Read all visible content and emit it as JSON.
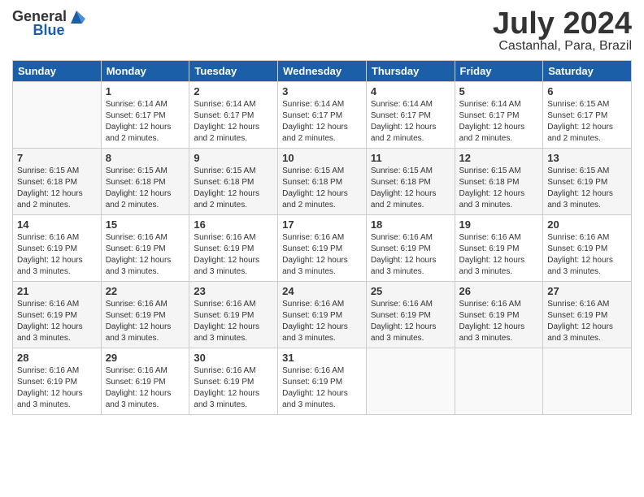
{
  "header": {
    "logo_general": "General",
    "logo_blue": "Blue",
    "month_title": "July 2024",
    "location": "Castanhal, Para, Brazil"
  },
  "days_of_week": [
    "Sunday",
    "Monday",
    "Tuesday",
    "Wednesday",
    "Thursday",
    "Friday",
    "Saturday"
  ],
  "weeks": [
    [
      {
        "day": "",
        "info": ""
      },
      {
        "day": "1",
        "info": "Sunrise: 6:14 AM\nSunset: 6:17 PM\nDaylight: 12 hours\nand 2 minutes."
      },
      {
        "day": "2",
        "info": "Sunrise: 6:14 AM\nSunset: 6:17 PM\nDaylight: 12 hours\nand 2 minutes."
      },
      {
        "day": "3",
        "info": "Sunrise: 6:14 AM\nSunset: 6:17 PM\nDaylight: 12 hours\nand 2 minutes."
      },
      {
        "day": "4",
        "info": "Sunrise: 6:14 AM\nSunset: 6:17 PM\nDaylight: 12 hours\nand 2 minutes."
      },
      {
        "day": "5",
        "info": "Sunrise: 6:14 AM\nSunset: 6:17 PM\nDaylight: 12 hours\nand 2 minutes."
      },
      {
        "day": "6",
        "info": "Sunrise: 6:15 AM\nSunset: 6:17 PM\nDaylight: 12 hours\nand 2 minutes."
      }
    ],
    [
      {
        "day": "7",
        "info": "Sunrise: 6:15 AM\nSunset: 6:18 PM\nDaylight: 12 hours\nand 2 minutes."
      },
      {
        "day": "8",
        "info": "Sunrise: 6:15 AM\nSunset: 6:18 PM\nDaylight: 12 hours\nand 2 minutes."
      },
      {
        "day": "9",
        "info": "Sunrise: 6:15 AM\nSunset: 6:18 PM\nDaylight: 12 hours\nand 2 minutes."
      },
      {
        "day": "10",
        "info": "Sunrise: 6:15 AM\nSunset: 6:18 PM\nDaylight: 12 hours\nand 2 minutes."
      },
      {
        "day": "11",
        "info": "Sunrise: 6:15 AM\nSunset: 6:18 PM\nDaylight: 12 hours\nand 2 minutes."
      },
      {
        "day": "12",
        "info": "Sunrise: 6:15 AM\nSunset: 6:18 PM\nDaylight: 12 hours\nand 3 minutes."
      },
      {
        "day": "13",
        "info": "Sunrise: 6:15 AM\nSunset: 6:19 PM\nDaylight: 12 hours\nand 3 minutes."
      }
    ],
    [
      {
        "day": "14",
        "info": "Sunrise: 6:16 AM\nSunset: 6:19 PM\nDaylight: 12 hours\nand 3 minutes."
      },
      {
        "day": "15",
        "info": "Sunrise: 6:16 AM\nSunset: 6:19 PM\nDaylight: 12 hours\nand 3 minutes."
      },
      {
        "day": "16",
        "info": "Sunrise: 6:16 AM\nSunset: 6:19 PM\nDaylight: 12 hours\nand 3 minutes."
      },
      {
        "day": "17",
        "info": "Sunrise: 6:16 AM\nSunset: 6:19 PM\nDaylight: 12 hours\nand 3 minutes."
      },
      {
        "day": "18",
        "info": "Sunrise: 6:16 AM\nSunset: 6:19 PM\nDaylight: 12 hours\nand 3 minutes."
      },
      {
        "day": "19",
        "info": "Sunrise: 6:16 AM\nSunset: 6:19 PM\nDaylight: 12 hours\nand 3 minutes."
      },
      {
        "day": "20",
        "info": "Sunrise: 6:16 AM\nSunset: 6:19 PM\nDaylight: 12 hours\nand 3 minutes."
      }
    ],
    [
      {
        "day": "21",
        "info": "Sunrise: 6:16 AM\nSunset: 6:19 PM\nDaylight: 12 hours\nand 3 minutes."
      },
      {
        "day": "22",
        "info": "Sunrise: 6:16 AM\nSunset: 6:19 PM\nDaylight: 12 hours\nand 3 minutes."
      },
      {
        "day": "23",
        "info": "Sunrise: 6:16 AM\nSunset: 6:19 PM\nDaylight: 12 hours\nand 3 minutes."
      },
      {
        "day": "24",
        "info": "Sunrise: 6:16 AM\nSunset: 6:19 PM\nDaylight: 12 hours\nand 3 minutes."
      },
      {
        "day": "25",
        "info": "Sunrise: 6:16 AM\nSunset: 6:19 PM\nDaylight: 12 hours\nand 3 minutes."
      },
      {
        "day": "26",
        "info": "Sunrise: 6:16 AM\nSunset: 6:19 PM\nDaylight: 12 hours\nand 3 minutes."
      },
      {
        "day": "27",
        "info": "Sunrise: 6:16 AM\nSunset: 6:19 PM\nDaylight: 12 hours\nand 3 minutes."
      }
    ],
    [
      {
        "day": "28",
        "info": "Sunrise: 6:16 AM\nSunset: 6:19 PM\nDaylight: 12 hours\nand 3 minutes."
      },
      {
        "day": "29",
        "info": "Sunrise: 6:16 AM\nSunset: 6:19 PM\nDaylight: 12 hours\nand 3 minutes."
      },
      {
        "day": "30",
        "info": "Sunrise: 6:16 AM\nSunset: 6:19 PM\nDaylight: 12 hours\nand 3 minutes."
      },
      {
        "day": "31",
        "info": "Sunrise: 6:16 AM\nSunset: 6:19 PM\nDaylight: 12 hours\nand 3 minutes."
      },
      {
        "day": "",
        "info": ""
      },
      {
        "day": "",
        "info": ""
      },
      {
        "day": "",
        "info": ""
      }
    ]
  ]
}
